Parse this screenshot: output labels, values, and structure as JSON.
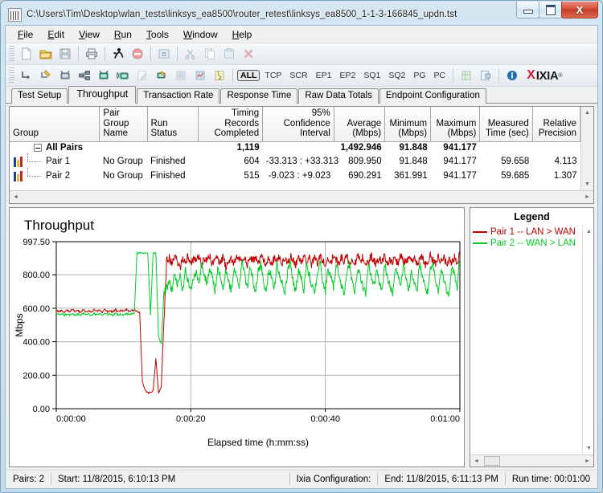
{
  "window": {
    "title": "C:\\Users\\Tim\\Desktop\\wlan_tests\\linksys_ea8500\\router_retest\\linksys_ea8500_1-1-3-166845_updn.tst",
    "app_icon": "ixchariot-icon",
    "minimize_label": "",
    "maximize_label": "",
    "close_label": "X"
  },
  "menu": {
    "items": [
      {
        "label": "File",
        "accel": "F"
      },
      {
        "label": "Edit",
        "accel": "E"
      },
      {
        "label": "View",
        "accel": "V"
      },
      {
        "label": "Run",
        "accel": "R"
      },
      {
        "label": "Tools",
        "accel": "T"
      },
      {
        "label": "Window",
        "accel": "W"
      },
      {
        "label": "Help",
        "accel": "H"
      }
    ]
  },
  "toolbar_top": {
    "icons": [
      "new-document-icon",
      "open-folder-icon",
      "save-disk-icon",
      "print-icon",
      "run-test-icon",
      "stop-test-icon",
      "swap-endpoints-icon",
      "cut-scissors-icon",
      "copy-icon",
      "paste-icon",
      "delete-icon"
    ]
  },
  "toolbar_bottom": {
    "icons": [
      "add-pair-icon",
      "add-pair-wizard-icon",
      "add-endpoint-icon",
      "add-multicast-group-icon",
      "add-video-pair-icon",
      "add-voip-pair-icon",
      "edit-pair-icon",
      "edit-script-icon",
      "validate-icon",
      "hardware-perf-icon",
      "number-pairs-icon"
    ],
    "filters": [
      {
        "label": "ALL",
        "selected": true
      },
      {
        "label": "TCP",
        "selected": false
      },
      {
        "label": "SCR",
        "selected": false
      },
      {
        "label": "EP1",
        "selected": false
      },
      {
        "label": "EP2",
        "selected": false
      },
      {
        "label": "SQ1",
        "selected": false
      },
      {
        "label": "SQ2",
        "selected": false
      },
      {
        "label": "PG",
        "selected": false
      },
      {
        "label": "PC",
        "selected": false
      }
    ],
    "right_icons": [
      "grid-view-icon",
      "export-icon",
      "info-icon"
    ],
    "logo_x": "X",
    "logo_name": "IXIA",
    "logo_tm": "®"
  },
  "tabs": [
    {
      "label": "Test Setup",
      "active": false
    },
    {
      "label": "Throughput",
      "active": true
    },
    {
      "label": "Transaction Rate",
      "active": false
    },
    {
      "label": "Response Time",
      "active": false
    },
    {
      "label": "Raw Data Totals",
      "active": false
    },
    {
      "label": "Endpoint Configuration",
      "active": false
    }
  ],
  "grid": {
    "columns": [
      "Group",
      "Pair Group\nName",
      "Run Status",
      "Timing Records\nCompleted",
      "95% Confidence\nInterval",
      "Average\n(Mbps)",
      "Minimum\n(Mbps)",
      "Maximum\n(Mbps)",
      "Measured\nTime (sec)",
      "Relative\nPrecision"
    ],
    "column_lines": [
      [
        "Group",
        ""
      ],
      [
        "Pair Group",
        "Name"
      ],
      [
        "Run Status",
        ""
      ],
      [
        "Timing Records",
        "Completed"
      ],
      [
        "95% Confidence",
        "Interval"
      ],
      [
        "Average",
        "(Mbps)"
      ],
      [
        "Minimum",
        "(Mbps)"
      ],
      [
        "Maximum",
        "(Mbps)"
      ],
      [
        "Measured",
        "Time (sec)"
      ],
      [
        "Relative",
        "Precision"
      ]
    ],
    "rows": [
      {
        "type": "total",
        "group": "All Pairs",
        "pair_group_name": "",
        "run_status": "",
        "timing_records": "1,119",
        "confidence_interval": "",
        "average": "1,492.946",
        "minimum": "91.848",
        "maximum": "941.177",
        "measured_time": "",
        "relative_precision": ""
      },
      {
        "type": "pair",
        "group": "Pair 1",
        "pair_group_name": "No Group",
        "run_status": "Finished",
        "timing_records": "604",
        "confidence_interval": "-33.313 : +33.313",
        "average": "809.950",
        "minimum": "91.848",
        "maximum": "941.177",
        "measured_time": "59.658",
        "relative_precision": "4.113"
      },
      {
        "type": "pair",
        "group": "Pair 2",
        "pair_group_name": "No Group",
        "run_status": "Finished",
        "timing_records": "515",
        "confidence_interval": "-9.023 : +9.023",
        "average": "690.291",
        "minimum": "361.991",
        "maximum": "941.177",
        "measured_time": "59.685",
        "relative_precision": "1.307"
      }
    ]
  },
  "legend": {
    "title": "Legend",
    "entries": [
      {
        "label": "Pair 1 -- LAN > WAN",
        "color": "#c00000"
      },
      {
        "label": "Pair 2 -- WAN > LAN",
        "color": "#00cc22"
      }
    ]
  },
  "statusbar": {
    "pairs": "Pairs: 2",
    "start": "Start: 11/8/2015, 6:10:13 PM",
    "configuration": "Ixia Configuration:",
    "end": "End: 11/8/2015, 6:11:13 PM",
    "runtime": "Run time: 00:01:00"
  },
  "chart_data": {
    "type": "line",
    "title": "Throughput",
    "xlabel": "Elapsed time (h:mm:ss)",
    "ylabel": "Mbps",
    "ylim": [
      0,
      997.5
    ],
    "yticks": [
      0,
      200,
      400,
      600,
      800,
      997.5
    ],
    "ytick_labels": [
      "0.00",
      "200.00",
      "400.00",
      "600.00",
      "800.00",
      "997.50"
    ],
    "xlim": [
      0,
      60
    ],
    "xticks": [
      0,
      20,
      40,
      60
    ],
    "xtick_labels": [
      "0:00:00",
      "0:00:20",
      "0:00:40",
      "0:01:00"
    ],
    "grid": true,
    "legend_position": "right-panel",
    "series": [
      {
        "name": "Pair 1 -- LAN > WAN",
        "color": "#c00000",
        "x": [
          0.0,
          0.4,
          0.8,
          1.2,
          1.6,
          2.0,
          2.4,
          2.8,
          3.2,
          3.6,
          4.0,
          4.4,
          4.8,
          5.2,
          5.6,
          6.0,
          6.4,
          6.8,
          7.2,
          7.6,
          8.0,
          8.4,
          8.8,
          9.2,
          9.6,
          10.0,
          10.4,
          10.8,
          11.2,
          11.6,
          12.0,
          12.4,
          12.8,
          13.2,
          13.6,
          14.0,
          14.4,
          14.8,
          15.2,
          15.6,
          16.0,
          16.4,
          16.8,
          17.2,
          17.6,
          18.0,
          18.4,
          18.8,
          19.2,
          19.6,
          20.0,
          20.4,
          20.8,
          21.2,
          21.6,
          22.0,
          22.4,
          22.8,
          23.2,
          23.6,
          24.0,
          24.4,
          24.8,
          25.2,
          25.6,
          26.0,
          26.4,
          26.8,
          27.2,
          27.6,
          28.0,
          28.4,
          28.8,
          29.2,
          29.6,
          30.0,
          30.4,
          30.8,
          31.2,
          31.6,
          32.0,
          32.4,
          32.8,
          33.2,
          33.6,
          34.0,
          34.4,
          34.8,
          35.2,
          35.6,
          36.0,
          36.4,
          36.8,
          37.2,
          37.6,
          38.0,
          38.4,
          38.8,
          39.2,
          39.6,
          40.0,
          40.4,
          40.8,
          41.2,
          41.6,
          42.0,
          42.4,
          42.8,
          43.2,
          43.6,
          44.0,
          44.4,
          44.8,
          45.2,
          45.6,
          46.0,
          46.4,
          46.8,
          47.2,
          47.6,
          48.0,
          48.4,
          48.8,
          49.2,
          49.6,
          50.0,
          50.4,
          50.8,
          51.2,
          51.6,
          52.0,
          52.4,
          52.8,
          53.2,
          53.6,
          54.0,
          54.4,
          54.8,
          55.2,
          55.6,
          56.0,
          56.4,
          56.8,
          57.2,
          57.6,
          58.0,
          58.4,
          58.8,
          59.2,
          59.6,
          60.0
        ],
        "y": [
          592,
          578,
          586,
          574,
          590,
          580,
          596,
          578,
          588,
          572,
          594,
          580,
          586,
          576,
          592,
          582,
          588,
          574,
          596,
          580,
          586,
          578,
          592,
          576,
          588,
          582,
          594,
          578,
          586,
          590,
          580,
          575,
          160,
          110,
          95,
          98,
          105,
          300,
          95,
          130,
          520,
          880,
          905,
          860,
          912,
          880,
          840,
          905,
          870,
          915,
          860,
          900,
          875,
          910,
          845,
          900,
          880,
          915,
          860,
          905,
          890,
          870,
          910,
          845,
          880,
          905,
          860,
          915,
          895,
          870,
          905,
          850,
          910,
          880,
          900,
          865,
          915,
          890,
          870,
          905,
          855,
          900,
          880,
          910,
          865,
          895,
          870,
          915,
          885,
          860,
          905,
          875,
          910,
          880,
          900,
          855,
          915,
          870,
          905,
          885,
          860,
          900,
          875,
          910,
          890,
          865,
          905,
          880,
          915,
          860,
          895,
          870,
          910,
          885,
          905,
          860,
          875,
          915,
          890,
          865,
          900,
          880,
          910,
          855,
          895,
          875,
          905,
          860,
          915,
          885,
          870,
          900,
          880,
          910,
          865,
          890,
          905,
          860,
          875,
          915,
          885,
          870,
          905,
          880,
          910,
          860,
          895,
          875,
          905,
          860,
          930
        ]
      },
      {
        "name": "Pair 2 -- WAN > LAN",
        "color": "#00cc22",
        "x": [
          0.0,
          0.4,
          0.8,
          1.2,
          1.6,
          2.0,
          2.4,
          2.8,
          3.2,
          3.6,
          4.0,
          4.4,
          4.8,
          5.2,
          5.6,
          6.0,
          6.4,
          6.8,
          7.2,
          7.6,
          8.0,
          8.4,
          8.8,
          9.2,
          9.6,
          10.0,
          10.4,
          10.8,
          11.2,
          11.6,
          12.0,
          12.4,
          12.8,
          13.2,
          13.6,
          14.0,
          14.4,
          14.8,
          15.2,
          15.6,
          16.0,
          16.4,
          16.8,
          17.2,
          17.6,
          18.0,
          18.4,
          18.8,
          19.2,
          19.6,
          20.0,
          20.4,
          20.8,
          21.2,
          21.6,
          22.0,
          22.4,
          22.8,
          23.2,
          23.6,
          24.0,
          24.4,
          24.8,
          25.2,
          25.6,
          26.0,
          26.4,
          26.8,
          27.2,
          27.6,
          28.0,
          28.4,
          28.8,
          29.2,
          29.6,
          30.0,
          30.4,
          30.8,
          31.2,
          31.6,
          32.0,
          32.4,
          32.8,
          33.2,
          33.6,
          34.0,
          34.4,
          34.8,
          35.2,
          35.6,
          36.0,
          36.4,
          36.8,
          37.2,
          37.6,
          38.0,
          38.4,
          38.8,
          39.2,
          39.6,
          40.0,
          40.4,
          40.8,
          41.2,
          41.6,
          42.0,
          42.4,
          42.8,
          43.2,
          43.6,
          44.0,
          44.4,
          44.8,
          45.2,
          45.6,
          46.0,
          46.4,
          46.8,
          47.2,
          47.6,
          48.0,
          48.4,
          48.8,
          49.2,
          49.6,
          50.0,
          50.4,
          50.8,
          51.2,
          51.6,
          52.0,
          52.4,
          52.8,
          53.2,
          53.6,
          54.0,
          54.4,
          54.8,
          55.2,
          55.6,
          56.0,
          56.4,
          56.8,
          57.2,
          57.6,
          58.0,
          58.4,
          58.8,
          59.2,
          59.6,
          60.0
        ],
        "y": [
          570,
          562,
          568,
          558,
          566,
          560,
          570,
          556,
          566,
          558,
          568,
          562,
          566,
          556,
          570,
          560,
          566,
          558,
          568,
          562,
          566,
          556,
          570,
          560,
          566,
          558,
          568,
          562,
          566,
          570,
          930,
          930,
          930,
          930,
          930,
          560,
          930,
          930,
          430,
          390,
          690,
          720,
          760,
          700,
          810,
          740,
          790,
          700,
          830,
          760,
          700,
          790,
          820,
          740,
          870,
          800,
          750,
          830,
          790,
          700,
          850,
          780,
          730,
          820,
          760,
          700,
          830,
          790,
          740,
          870,
          800,
          720,
          850,
          780,
          690,
          820,
          870,
          760,
          700,
          830,
          790,
          720,
          860,
          800,
          740,
          690,
          820,
          870,
          760,
          700,
          840,
          780,
          710,
          860,
          800,
          730,
          690,
          820,
          870,
          760,
          700,
          840,
          790,
          720,
          860,
          800,
          730,
          690,
          820,
          870,
          750,
          700,
          840,
          790,
          720,
          690,
          860,
          800,
          730,
          820,
          760,
          700,
          870,
          790,
          730,
          690,
          840,
          800,
          720,
          860,
          780,
          700,
          830,
          750,
          690,
          870,
          800,
          730,
          690,
          820,
          860,
          750,
          700,
          830,
          780,
          710,
          690,
          850,
          800,
          720,
          930
        ]
      }
    ]
  }
}
